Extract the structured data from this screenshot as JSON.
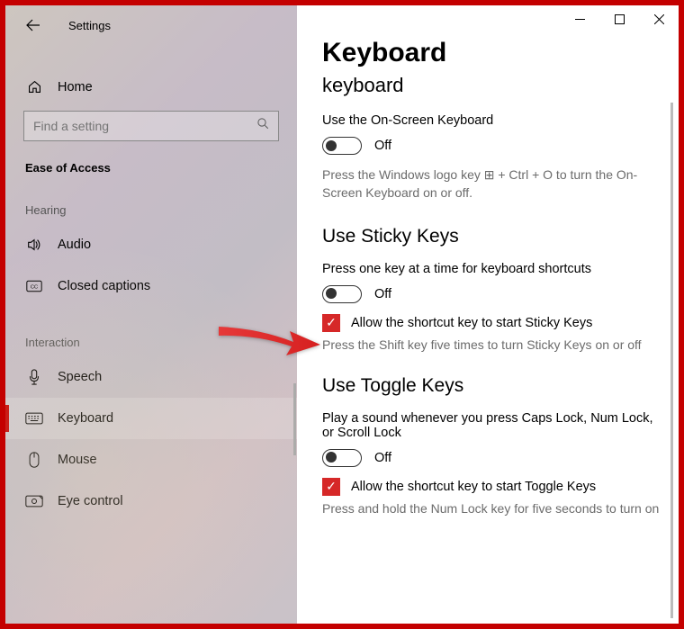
{
  "window": {
    "title": "Settings"
  },
  "sidebar": {
    "home": "Home",
    "search_placeholder": "Find a setting",
    "category": "Ease of Access",
    "groups": {
      "hearing": "Hearing",
      "interaction": "Interaction"
    },
    "items": {
      "audio": "Audio",
      "cc": "Closed captions",
      "speech": "Speech",
      "keyboard": "Keyboard",
      "mouse": "Mouse",
      "eye": "Eye control"
    }
  },
  "content": {
    "page_title": "Keyboard",
    "subheading": "keyboard",
    "osk": {
      "heading": "Use the On-Screen Keyboard",
      "state": "Off",
      "hint": "Press the Windows logo key ⊞ + Ctrl + O to turn the On-Screen Keyboard on or off."
    },
    "sticky": {
      "heading": "Use Sticky Keys",
      "line": "Press one key at a time for keyboard shortcuts",
      "state": "Off",
      "chk_label": "Allow the shortcut key to start Sticky Keys",
      "chk_checked": true,
      "hint": "Press the Shift key five times to turn Sticky Keys on or off"
    },
    "toggle": {
      "heading": "Use Toggle Keys",
      "line": "Play a sound whenever you press Caps Lock, Num Lock, or Scroll Lock",
      "state": "Off",
      "chk_label": "Allow the shortcut key to start Toggle Keys",
      "chk_checked": true,
      "hint": "Press and hold the Num Lock key for five seconds to turn on"
    }
  }
}
